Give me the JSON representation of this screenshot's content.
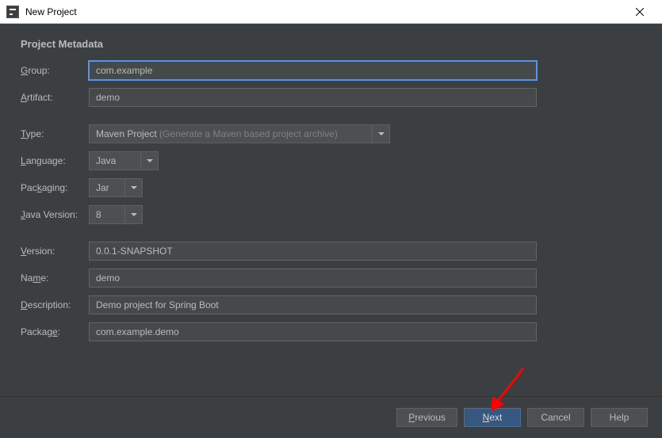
{
  "window": {
    "title": "New Project"
  },
  "section": {
    "title": "Project Metadata"
  },
  "labels": {
    "group": "Group:",
    "artifact": "Artifact:",
    "type": "Type:",
    "language": "Language:",
    "packaging": "Packaging:",
    "javaVersion": "Java Version:",
    "version": "Version:",
    "name": "Name:",
    "description": "Description:",
    "package": "Package:"
  },
  "fields": {
    "group": "com.example",
    "artifact": "demo",
    "type": "Maven Project",
    "typeHint": "(Generate a Maven based project archive)",
    "language": "Java",
    "packaging": "Jar",
    "javaVersion": "8",
    "version": "0.0.1-SNAPSHOT",
    "name": "demo",
    "description": "Demo project for Spring Boot",
    "package": "com.example.demo"
  },
  "buttons": {
    "previous": "Previous",
    "next": "Next",
    "cancel": "Cancel",
    "help": "Help"
  }
}
